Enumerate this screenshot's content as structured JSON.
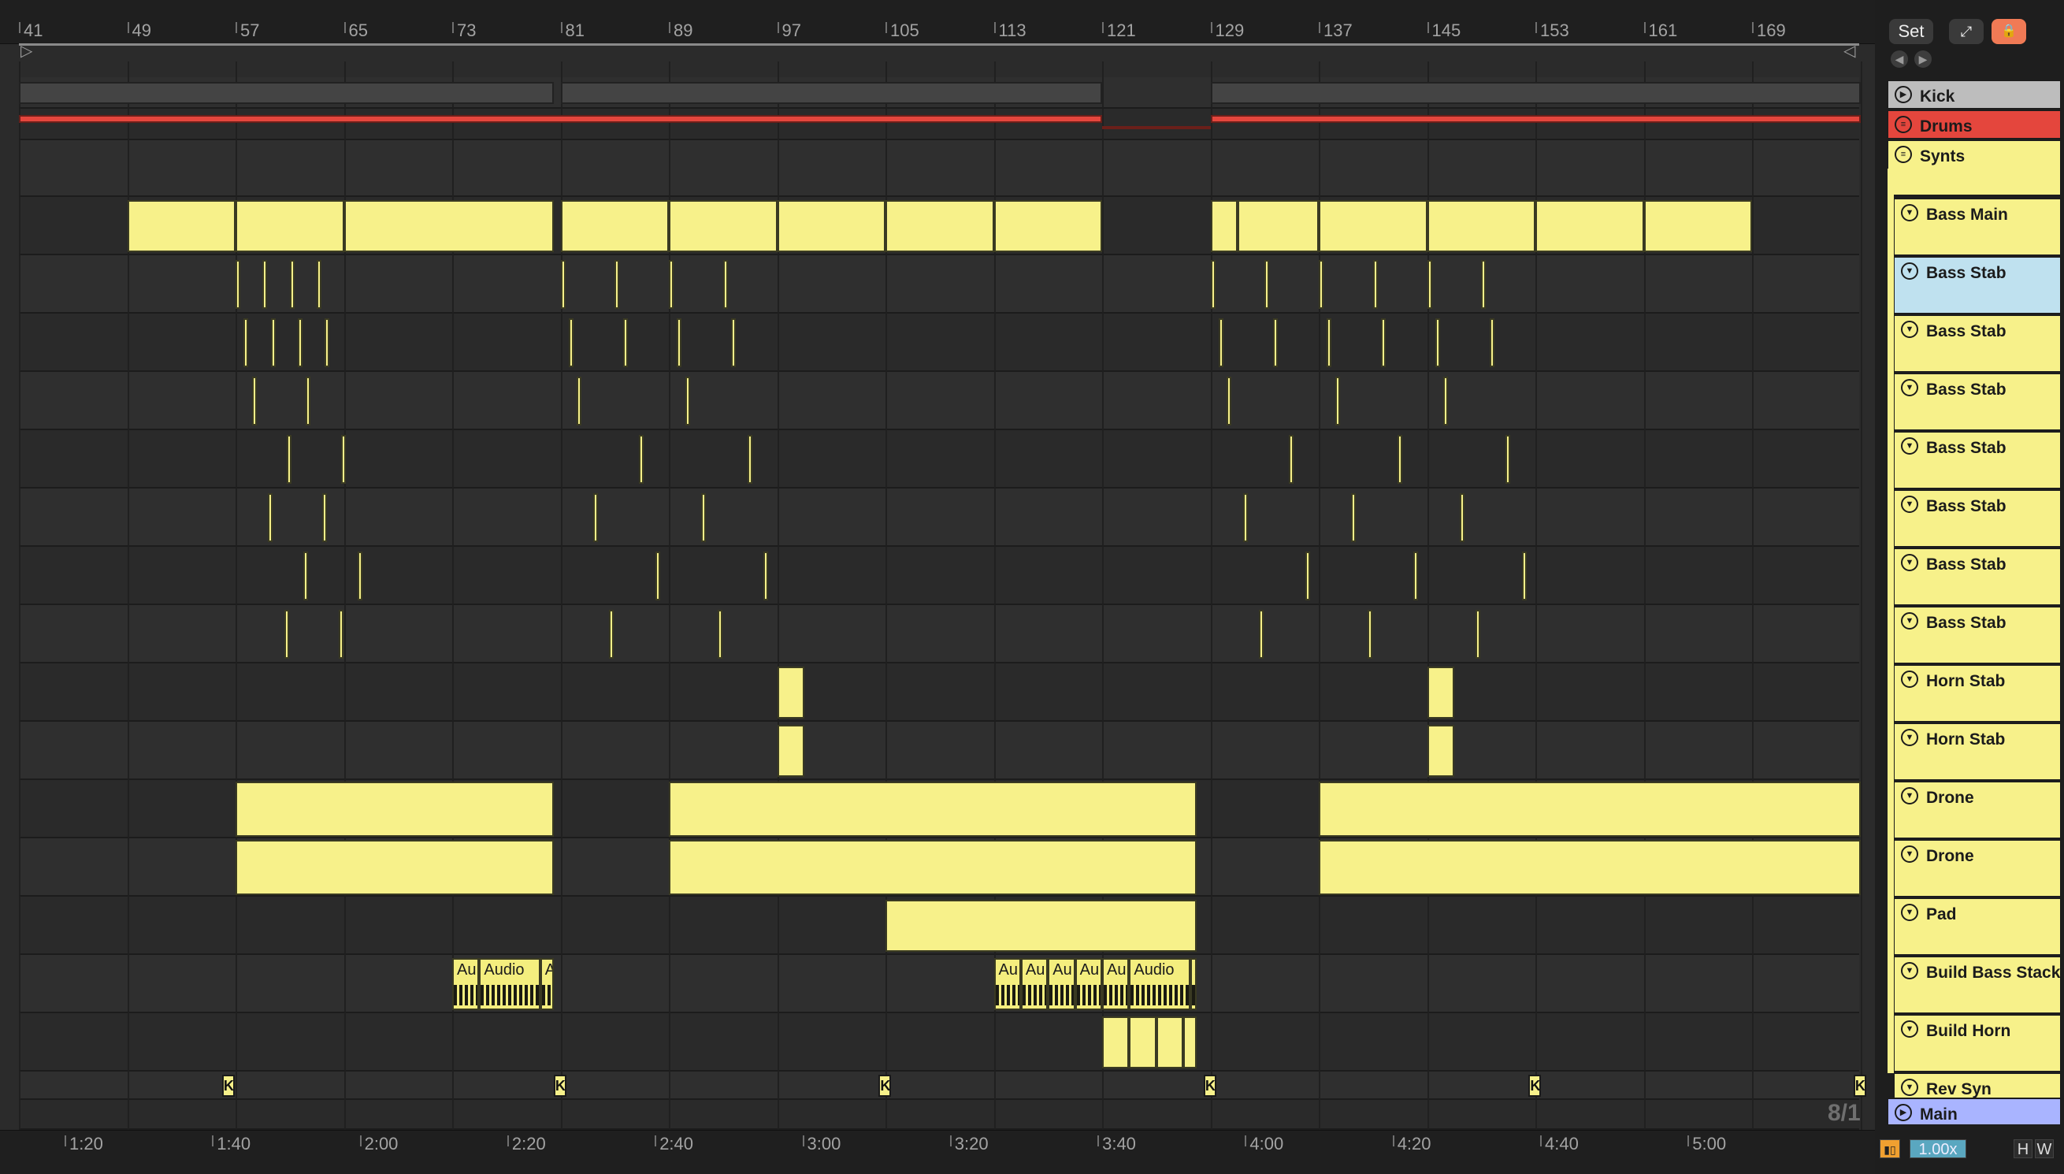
{
  "ruler": {
    "bars": [
      "41",
      "49",
      "57",
      "65",
      "73",
      "81",
      "89",
      "97",
      "105",
      "113",
      "121",
      "129",
      "137",
      "145",
      "153",
      "161",
      "169"
    ]
  },
  "time_ruler": {
    "labels": [
      "1:20",
      "1:40",
      "2:00",
      "2:20",
      "2:40",
      "3:00",
      "3:20",
      "3:40",
      "4:00",
      "4:20",
      "4:40",
      "5:00"
    ]
  },
  "right_panel": {
    "set_label": "Set",
    "expand_icon": "expand-icon",
    "lock_icon": "lock-icon",
    "tracks": [
      {
        "name": "Kick",
        "color": "#bdbdbd",
        "icon": "play-icon",
        "group": false
      },
      {
        "name": "Drums",
        "color": "#e4463d",
        "icon": "group-icon",
        "group": false
      },
      {
        "name": "Synts",
        "color": "#f7f18a",
        "icon": "group-icon",
        "group": true
      },
      {
        "name": "Bass Main",
        "color": "#f7f18a",
        "icon": "fold-icon"
      },
      {
        "name": "Bass Stab",
        "color": "#bfe1ef",
        "icon": "fold-icon",
        "selected": true
      },
      {
        "name": "Bass Stab",
        "color": "#f7f18a",
        "icon": "fold-icon"
      },
      {
        "name": "Bass Stab",
        "color": "#f7f18a",
        "icon": "fold-icon"
      },
      {
        "name": "Bass Stab",
        "color": "#f7f18a",
        "icon": "fold-icon"
      },
      {
        "name": "Bass Stab",
        "color": "#f7f18a",
        "icon": "fold-icon"
      },
      {
        "name": "Bass Stab",
        "color": "#f7f18a",
        "icon": "fold-icon"
      },
      {
        "name": "Bass Stab",
        "color": "#f7f18a",
        "icon": "fold-icon"
      },
      {
        "name": "Horn Stab",
        "color": "#f7f18a",
        "icon": "fold-icon"
      },
      {
        "name": "Horn Stab",
        "color": "#f7f18a",
        "icon": "fold-icon"
      },
      {
        "name": "Drone",
        "color": "#f7f18a",
        "icon": "fold-icon"
      },
      {
        "name": "Drone",
        "color": "#f7f18a",
        "icon": "fold-icon"
      },
      {
        "name": "Pad",
        "color": "#f7f18a",
        "icon": "fold-icon"
      },
      {
        "name": "Build Bass Stack",
        "color": "#f7f18a",
        "icon": "fold-icon"
      },
      {
        "name": "Build Horn",
        "color": "#f7f18a",
        "icon": "fold-icon"
      },
      {
        "name": "Rev Syn",
        "color": "#f7f18a",
        "icon": "fold-icon"
      },
      {
        "name": "Main",
        "color": "#a9b4ff",
        "icon": "play-icon"
      }
    ]
  },
  "clips": {
    "audio_name_short": "Au",
    "audio_name": "Audio",
    "audio_name_tiny": "A",
    "marker_label": "K"
  },
  "bottom": {
    "zoom_ratio": "8/1",
    "tempo_scale": "1.00x",
    "h_label": "H",
    "w_label": "W"
  },
  "colors": {
    "accent_yellow": "#f7f18a",
    "drums_red": "#e4463d",
    "selected_blue": "#bfe1ef",
    "main_blue": "#a9b4ff",
    "lock_orange": "#f07a55"
  }
}
